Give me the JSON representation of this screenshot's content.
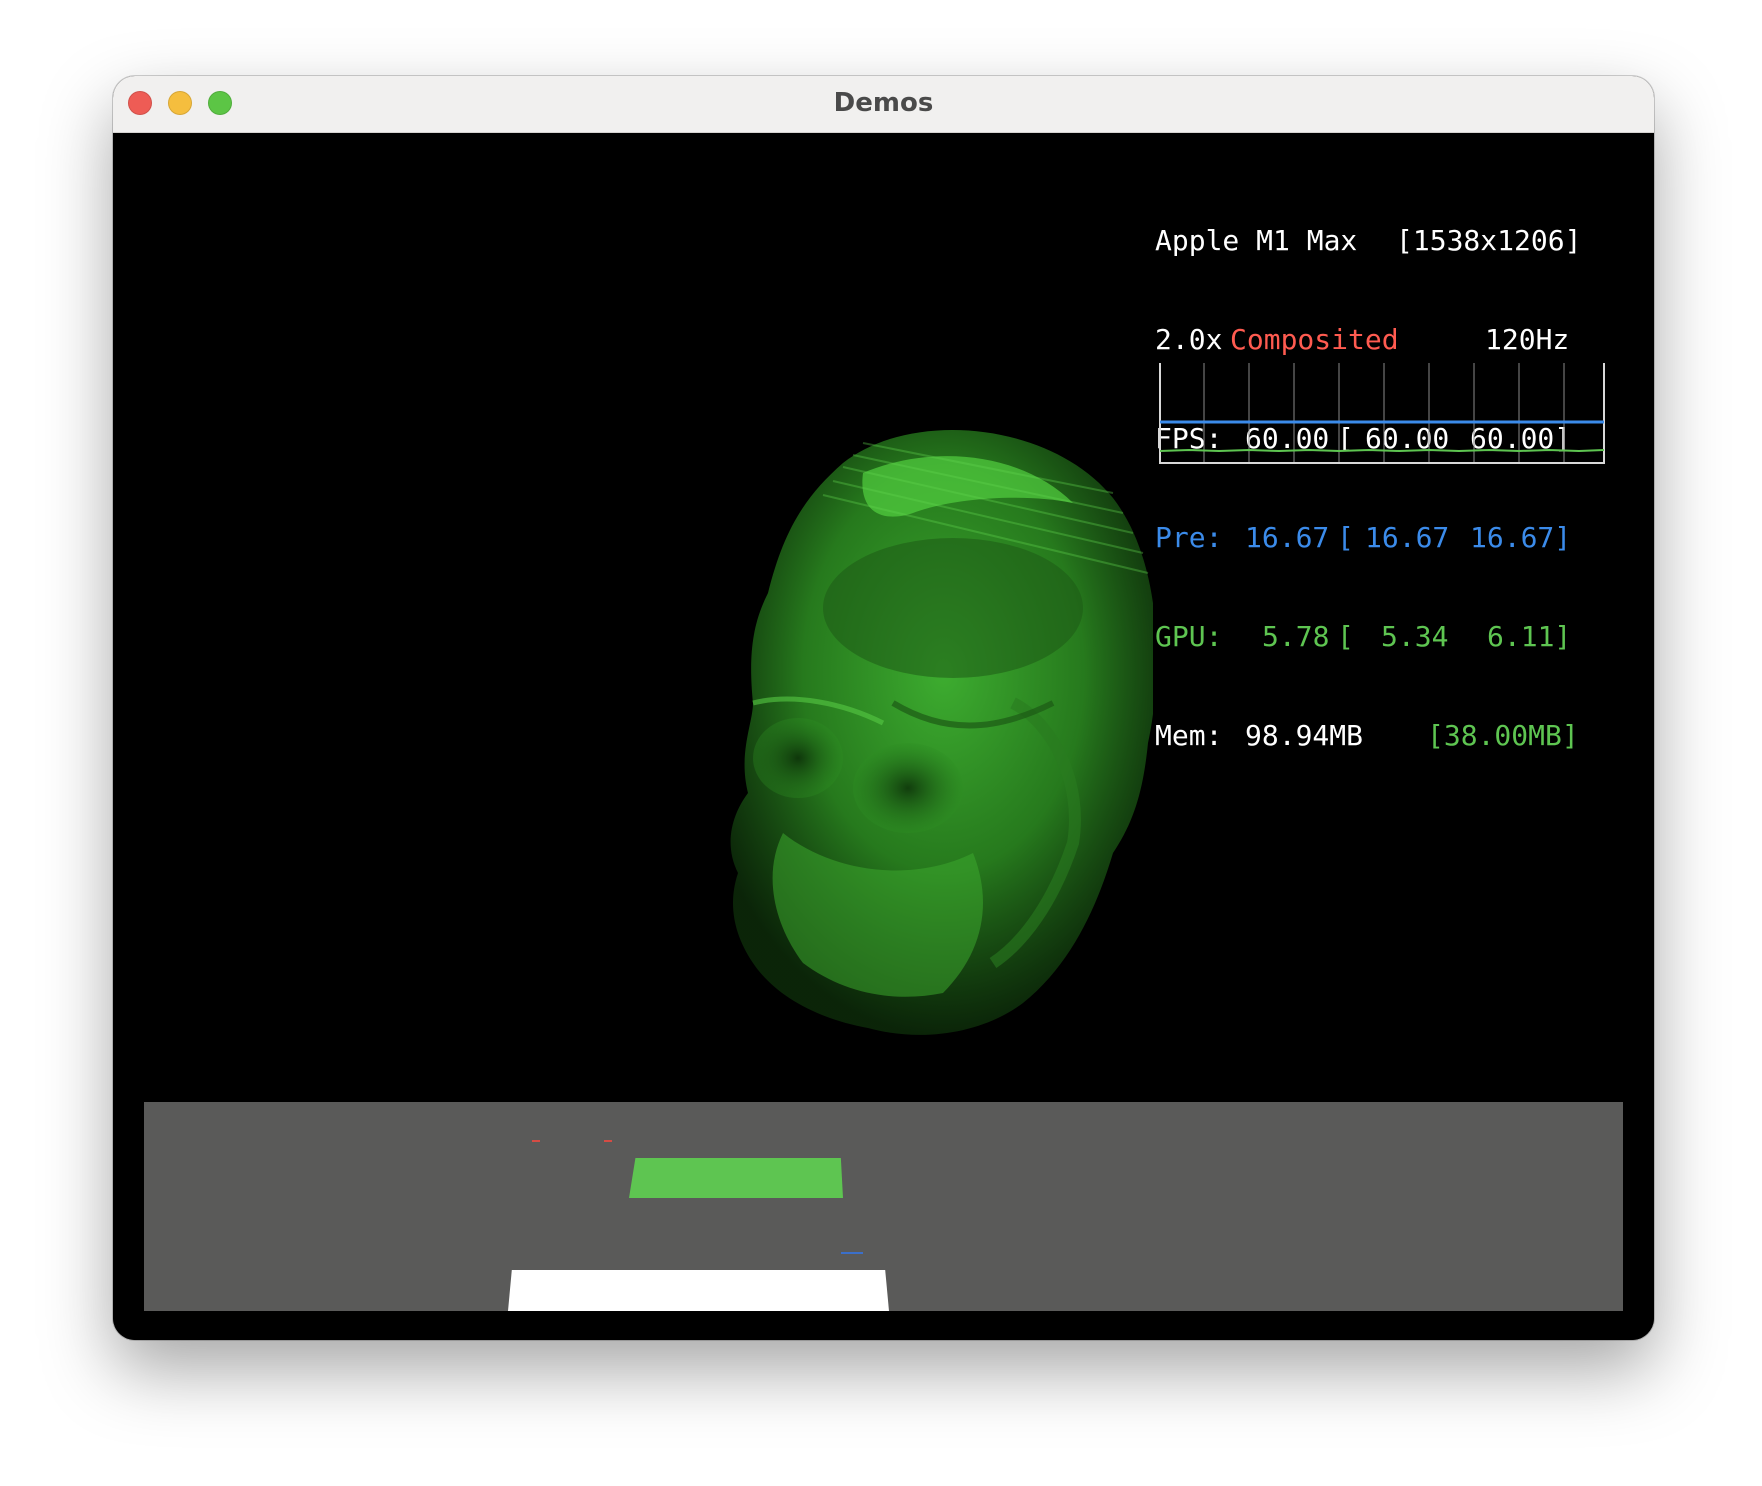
{
  "window": {
    "title": "Demos"
  },
  "stats": {
    "gpu_name": "Apple M1 Max",
    "resolution": "[1538x1206]",
    "scale": "2.0x",
    "mode": "Composited",
    "refresh": "120Hz",
    "fps": {
      "label": "FPS:",
      "current": "60.00",
      "open": "[",
      "min": "60.00",
      "max": "60.00]"
    },
    "pre": {
      "label": "Pre:",
      "current": "16.67",
      "open": "[",
      "min": "16.67",
      "max": "16.67]"
    },
    "gpu": {
      "label": "GPU:",
      "current": "5.78",
      "open": "[",
      "min": "5.34",
      "max": "6.11]"
    },
    "mem": {
      "label": "Mem:",
      "current": "98.94MB",
      "peak": "[38.00MB]"
    }
  },
  "colors": {
    "composited": "#ff5b50",
    "pre": "#3b8bea",
    "gpu": "#5ec551",
    "volume": "#3fbf2e",
    "panel": "#5a5a59"
  },
  "icons": {
    "close": "red-close-icon",
    "minimize": "yellow-minimize-icon",
    "maximize": "green-zoom-icon"
  }
}
